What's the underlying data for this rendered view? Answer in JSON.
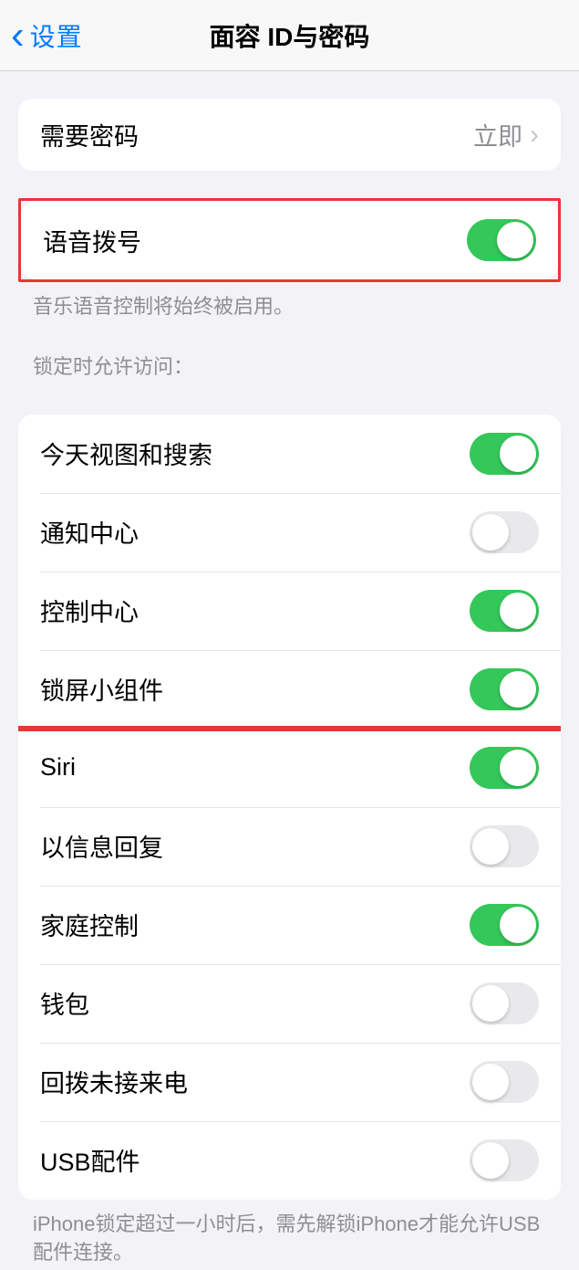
{
  "nav": {
    "back_label": "设置",
    "title": "面容 ID与密码"
  },
  "require_passcode": {
    "label": "需要密码",
    "value": "立即"
  },
  "voice_dial": {
    "label": "语音拨号",
    "on": true,
    "footer": "音乐语音控制将始终被启用。"
  },
  "lock_access": {
    "header": "锁定时允许访问：",
    "items": [
      {
        "label": "今天视图和搜索",
        "on": true
      },
      {
        "label": "通知中心",
        "on": false
      },
      {
        "label": "控制中心",
        "on": true
      },
      {
        "label": "锁屏小组件",
        "on": true
      },
      {
        "label": "Siri",
        "on": true
      },
      {
        "label": "以信息回复",
        "on": false
      },
      {
        "label": "家庭控制",
        "on": true
      },
      {
        "label": "钱包",
        "on": false
      },
      {
        "label": "回拨未接来电",
        "on": false
      },
      {
        "label": "USB配件",
        "on": false
      }
    ],
    "footer": "iPhone锁定超过一小时后，需先解锁iPhone才能允许USB配件连接。"
  }
}
